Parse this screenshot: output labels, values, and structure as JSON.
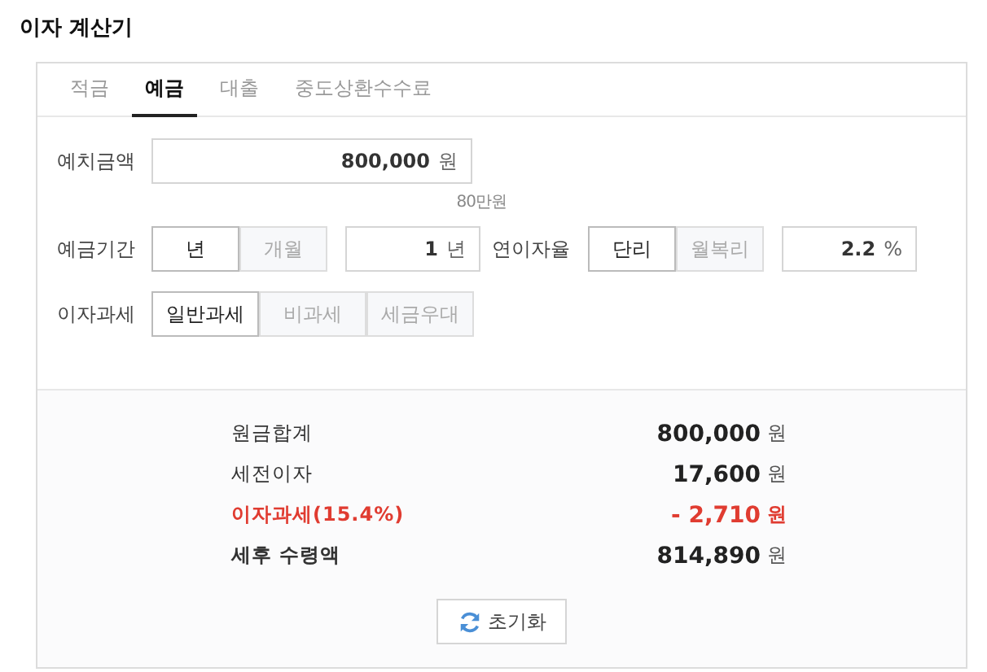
{
  "title": "이자 계산기",
  "tabs": [
    {
      "label": "적금",
      "selected": false
    },
    {
      "label": "예금",
      "selected": true
    },
    {
      "label": "대출",
      "selected": false
    },
    {
      "label": "중도상환수수료",
      "selected": false
    }
  ],
  "deposit": {
    "label": "예치금액",
    "value": "800,000",
    "unit": "원",
    "hint": "80만원"
  },
  "period": {
    "label": "예금기간",
    "options": [
      {
        "label": "년",
        "selected": true
      },
      {
        "label": "개월",
        "selected": false
      }
    ],
    "value": "1",
    "unit": "년"
  },
  "rate": {
    "label": "연이자율",
    "options": [
      {
        "label": "단리",
        "selected": true
      },
      {
        "label": "월복리",
        "selected": false
      }
    ],
    "value": "2.2",
    "unit": "%"
  },
  "taxation": {
    "label": "이자과세",
    "options": [
      {
        "label": "일반과세",
        "selected": true
      },
      {
        "label": "비과세",
        "selected": false
      },
      {
        "label": "세금우대",
        "selected": false
      }
    ]
  },
  "results": [
    {
      "kind": "normal",
      "label": "원금합계",
      "value": "800,000",
      "unit": "원"
    },
    {
      "kind": "normal",
      "label": "세전이자",
      "value": "17,600",
      "unit": "원"
    },
    {
      "kind": "tax",
      "label": "이자과세(15.4%)",
      "value": "- 2,710",
      "unit": "원"
    },
    {
      "kind": "total",
      "label": "세후 수령액",
      "value": "814,890",
      "unit": "원"
    }
  ],
  "reset_button": "초기화"
}
